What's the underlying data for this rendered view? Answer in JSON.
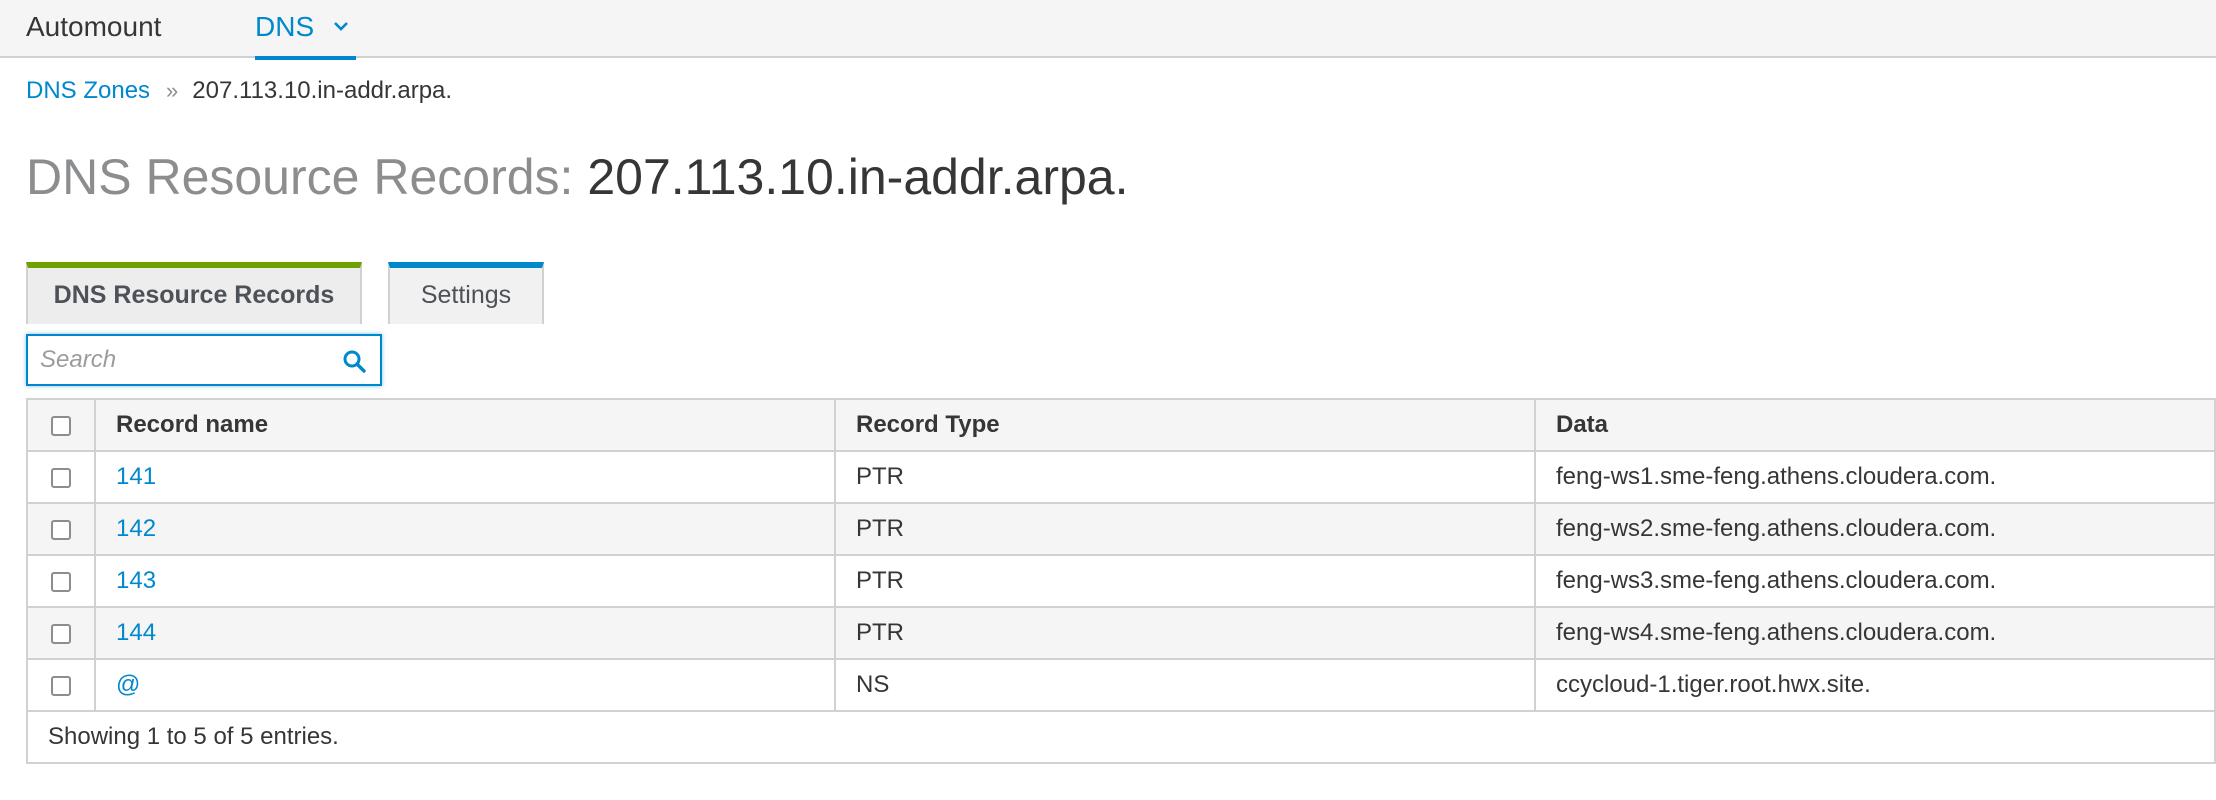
{
  "nav": {
    "items": [
      {
        "label": "Automount"
      },
      {
        "label": "DNS"
      }
    ]
  },
  "breadcrumb": {
    "parent": "DNS Zones",
    "current": "207.113.10.in-addr.arpa."
  },
  "page": {
    "title_prefix": "DNS Resource Records:",
    "title_zone": "207.113.10.in-addr.arpa."
  },
  "tabs": [
    {
      "label": "DNS Resource Records",
      "active": true
    },
    {
      "label": "Settings",
      "active": false
    }
  ],
  "search": {
    "placeholder": "Search",
    "value": ""
  },
  "table": {
    "columns": [
      "Record name",
      "Record Type",
      "Data"
    ],
    "rows": [
      {
        "name": "141",
        "type": "PTR",
        "data": "feng-ws1.sme-feng.athens.cloudera.com."
      },
      {
        "name": "142",
        "type": "PTR",
        "data": "feng-ws2.sme-feng.athens.cloudera.com."
      },
      {
        "name": "143",
        "type": "PTR",
        "data": "feng-ws3.sme-feng.athens.cloudera.com."
      },
      {
        "name": "144",
        "type": "PTR",
        "data": "feng-ws4.sme-feng.athens.cloudera.com."
      },
      {
        "name": "@",
        "type": "NS",
        "data": "ccycloud-1.tiger.root.hwx.site."
      }
    ],
    "footer": "Showing 1 to 5 of 5 entries."
  },
  "colors": {
    "link": "#0088ce",
    "active_tab_accent": "#6ca100",
    "settings_tab_accent": "#0088ce"
  }
}
